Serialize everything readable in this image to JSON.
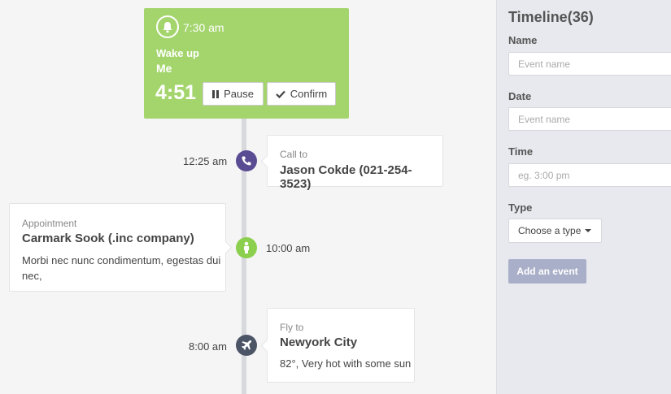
{
  "alarm": {
    "time": "7:30 am",
    "label": "Wake up",
    "who": "Me",
    "countdown": "4:51",
    "pause_label": "Pause",
    "confirm_label": "Confirm",
    "color": "#a4d56d"
  },
  "events": [
    {
      "time": "12:25 am",
      "kind": "Call to",
      "title": "Jason Cokde (021-254-3523)",
      "icon": "phone-icon",
      "color": "#5a4c93"
    },
    {
      "time": "10:00 am",
      "kind": "Appointment",
      "title": "Carmark Sook (.inc company)",
      "description": "Morbi nec nunc condimentum, egestas dui nec,",
      "icon": "person-icon",
      "color": "#8ccf4e"
    },
    {
      "time": "8:00 am",
      "kind": "Fly to",
      "title": "Newyork City",
      "description": "82°, Very hot with some sun",
      "icon": "plane-icon",
      "color": "#4c5565"
    }
  ],
  "panel": {
    "title": "Timeline(36)",
    "name_label": "Name",
    "name_placeholder": "Event name",
    "date_label": "Date",
    "date_placeholder": "Event name",
    "time_label": "Time",
    "time_placeholder": "eg. 3:00 pm",
    "type_label": "Type",
    "type_value": "Choose a type",
    "add_label": "Add an event",
    "add_color": "#a9afc8"
  }
}
